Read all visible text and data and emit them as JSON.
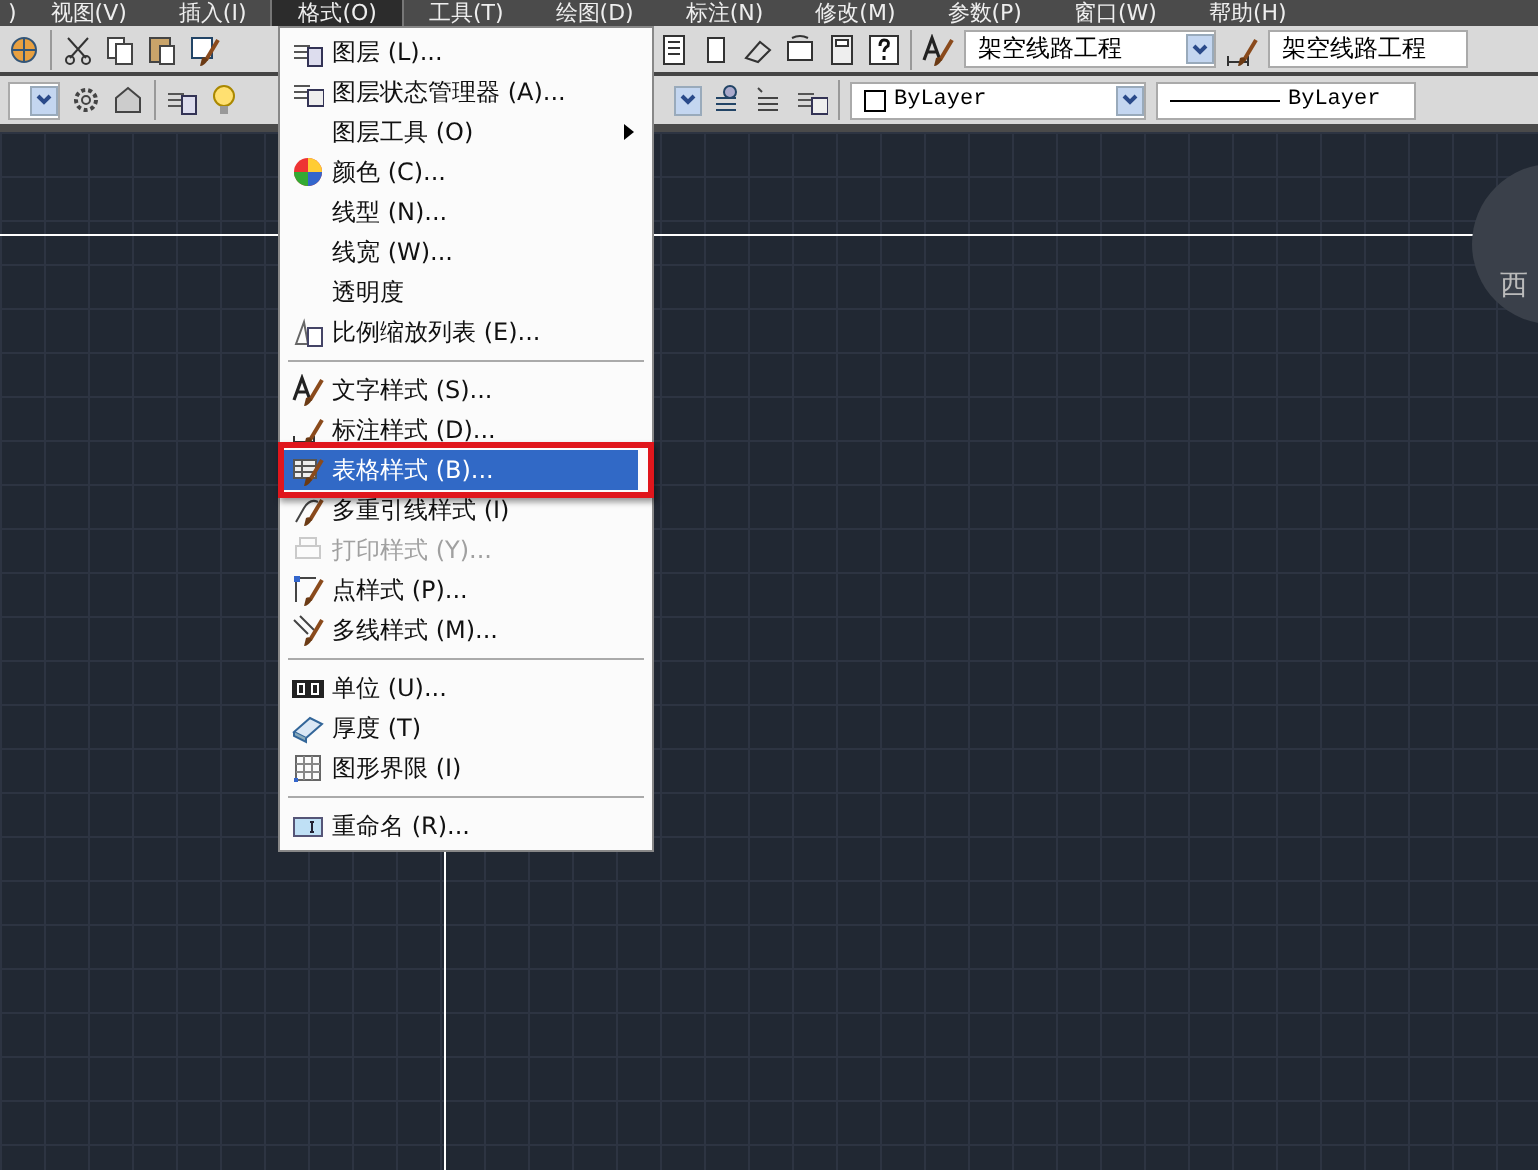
{
  "menubar": {
    "items": [
      {
        "label": ")",
        "selected": false
      },
      {
        "label": "视图(V)",
        "selected": false
      },
      {
        "label": "插入(I)",
        "selected": false
      },
      {
        "label": "格式(O)",
        "selected": true
      },
      {
        "label": "工具(T)",
        "selected": false
      },
      {
        "label": "绘图(D)",
        "selected": false
      },
      {
        "label": "标注(N)",
        "selected": false
      },
      {
        "label": "修改(M)",
        "selected": false
      },
      {
        "label": "参数(P)",
        "selected": false
      },
      {
        "label": "窗口(W)",
        "selected": false
      },
      {
        "label": "帮助(H)",
        "selected": false
      }
    ]
  },
  "toolbar": {
    "text_style": "架空线路工程",
    "dim_style": "架空线路工程",
    "color_combo": "ByLayer",
    "linetype": "ByLayer"
  },
  "format_menu": {
    "items": [
      {
        "kind": "item",
        "label": "图层 (L)...",
        "selected": false,
        "disabled": false,
        "submenu": false,
        "annotated": false
      },
      {
        "kind": "item",
        "label": "图层状态管理器 (A)...",
        "selected": false,
        "disabled": false,
        "submenu": false,
        "annotated": false
      },
      {
        "kind": "item",
        "label": "图层工具 (O)",
        "selected": false,
        "disabled": false,
        "submenu": true,
        "annotated": false
      },
      {
        "kind": "item",
        "label": "颜色 (C)...",
        "selected": false,
        "disabled": false,
        "submenu": false,
        "annotated": false
      },
      {
        "kind": "item",
        "label": "线型 (N)...",
        "selected": false,
        "disabled": false,
        "submenu": false,
        "annotated": false
      },
      {
        "kind": "item",
        "label": "线宽 (W)...",
        "selected": false,
        "disabled": false,
        "submenu": false,
        "annotated": false
      },
      {
        "kind": "item",
        "label": "透明度",
        "selected": false,
        "disabled": false,
        "submenu": false,
        "annotated": false
      },
      {
        "kind": "item",
        "label": "比例缩放列表 (E)...",
        "selected": false,
        "disabled": false,
        "submenu": false,
        "annotated": false
      },
      {
        "kind": "separator"
      },
      {
        "kind": "item",
        "label": "文字样式 (S)...",
        "selected": false,
        "disabled": false,
        "submenu": false,
        "annotated": false
      },
      {
        "kind": "item",
        "label": "标注样式 (D)...",
        "selected": false,
        "disabled": false,
        "submenu": false,
        "annotated": false
      },
      {
        "kind": "item",
        "label": "表格样式 (B)...",
        "selected": true,
        "disabled": false,
        "submenu": false,
        "annotated": true
      },
      {
        "kind": "item",
        "label": "多重引线样式 (I)",
        "selected": false,
        "disabled": false,
        "submenu": false,
        "annotated": false
      },
      {
        "kind": "item",
        "label": "打印样式 (Y)...",
        "selected": false,
        "disabled": true,
        "submenu": false,
        "annotated": false
      },
      {
        "kind": "item",
        "label": "点样式 (P)...",
        "selected": false,
        "disabled": false,
        "submenu": false,
        "annotated": false
      },
      {
        "kind": "item",
        "label": "多线样式 (M)...",
        "selected": false,
        "disabled": false,
        "submenu": false,
        "annotated": false
      },
      {
        "kind": "separator"
      },
      {
        "kind": "item",
        "label": "单位 (U)...",
        "selected": false,
        "disabled": false,
        "submenu": false,
        "annotated": false
      },
      {
        "kind": "item",
        "label": "厚度 (T)",
        "selected": false,
        "disabled": false,
        "submenu": false,
        "annotated": false
      },
      {
        "kind": "item",
        "label": "图形界限 (I)",
        "selected": false,
        "disabled": false,
        "submenu": false,
        "annotated": false
      },
      {
        "kind": "separator"
      },
      {
        "kind": "item",
        "label": "重命名 (R)...",
        "selected": false,
        "disabled": false,
        "submenu": false,
        "annotated": false
      }
    ]
  },
  "viewcube": {
    "label": "西"
  }
}
